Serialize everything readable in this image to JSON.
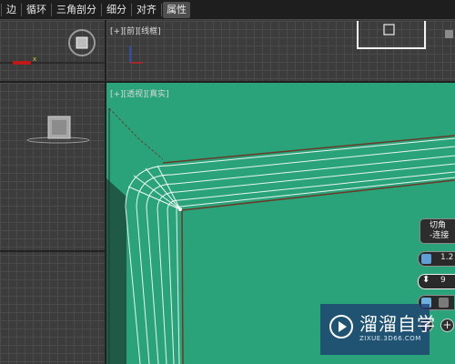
{
  "menu": {
    "items": [
      {
        "label": "边",
        "active": false
      },
      {
        "label": "循环",
        "active": false
      },
      {
        "label": "三角剖分",
        "active": false
      },
      {
        "label": "细分",
        "active": false
      },
      {
        "label": "对齐",
        "active": false
      },
      {
        "label": "属性",
        "active": true
      }
    ]
  },
  "viewports": {
    "top_right": {
      "plus": "[+]",
      "view": "[前]",
      "shading": "[线框]"
    },
    "persp": {
      "plus": "[+]",
      "view": "[透视]",
      "shading": "[真实]"
    }
  },
  "caddy": {
    "title_line1": "切角",
    "title_line2": "-连接",
    "amount_value": "1.2",
    "segments_value": "9",
    "add_label": "+"
  },
  "watermark": {
    "brand": "溜溜自学",
    "url": "ZIXUE.3D66.COM"
  },
  "colors": {
    "model_green": "#2aa37a",
    "grid_bg": "#3c3c3c",
    "menubar_bg": "#1e1e1e",
    "watermark_bg": "#1e3c6e"
  }
}
